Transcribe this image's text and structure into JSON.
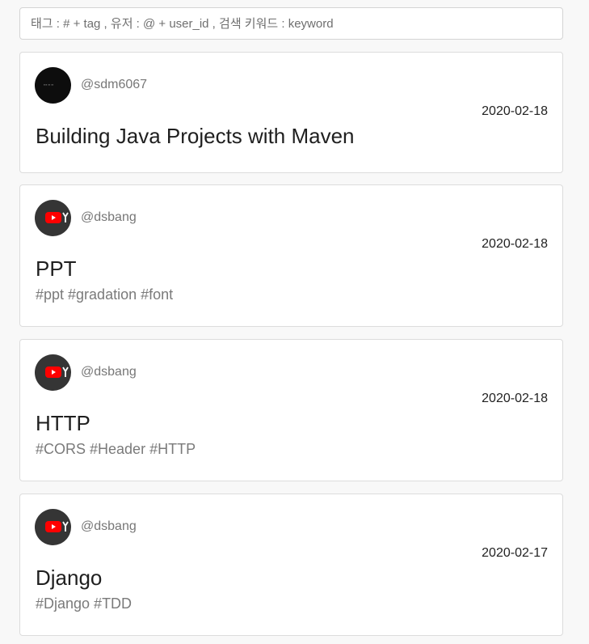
{
  "search": {
    "placeholder": "태그 : # + tag , 유저 : @ + user_id , 검색 키워드 : keyword"
  },
  "posts": [
    {
      "username": "@sdm6067",
      "date": "2020-02-18",
      "title": "Building Java Projects with Maven",
      "tags": "",
      "avatar": "dark-avatar"
    },
    {
      "username": "@dsbang",
      "date": "2020-02-18",
      "title": "PPT",
      "tags": "#ppt #gradation #font",
      "avatar": "youtube-icon"
    },
    {
      "username": "@dsbang",
      "date": "2020-02-18",
      "title": "HTTP",
      "tags": "#CORS #Header #HTTP",
      "avatar": "youtube-icon"
    },
    {
      "username": "@dsbang",
      "date": "2020-02-17",
      "title": "Django",
      "tags": "#Django #TDD",
      "avatar": "youtube-icon"
    }
  ],
  "colors": {
    "background": "#f8f8f8",
    "card": "#ffffff",
    "border": "#dcdcdc",
    "youtube_red": "#ff0000"
  }
}
